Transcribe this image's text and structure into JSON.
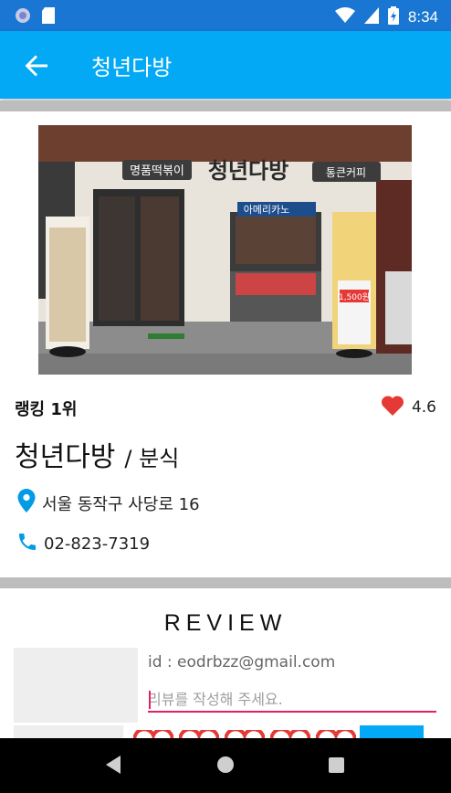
{
  "status_bar": {
    "time": "8:34"
  },
  "app_bar": {
    "title": "청년다방"
  },
  "store": {
    "rank": "랭킹 1위",
    "rating": "4.6",
    "name": "청년다방",
    "category": "/ 분식",
    "address": "서울 동작구 사당로 16",
    "phone": "02-823-7319",
    "photo_signs": {
      "main": "청년다방",
      "left": "명품떡볶이",
      "right": "통큰커피",
      "americano": "아메리카노",
      "americano_price": "1,500원"
    }
  },
  "review": {
    "title": "REVIEW",
    "user_id": "id : eodrbzz@gmail.com",
    "input_placeholder": "리뷰를 작성해 주세요."
  },
  "colors": {
    "status_bar": "#1976d2",
    "app_bar": "#03a9f4",
    "accent": "#e91e63",
    "heart": "#e53935"
  }
}
